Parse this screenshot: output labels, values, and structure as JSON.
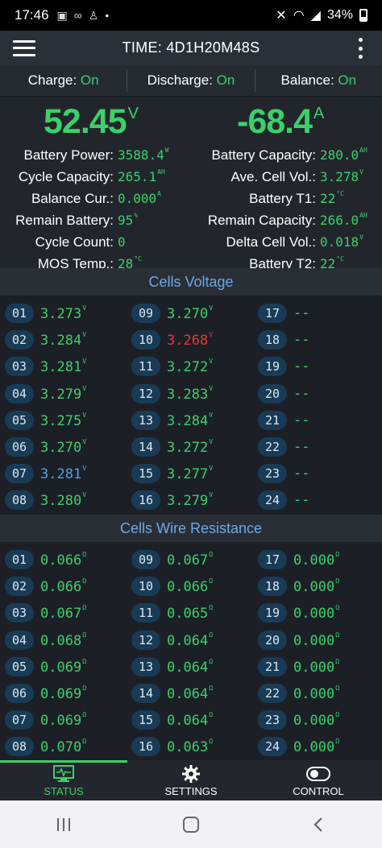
{
  "status_bar": {
    "time": "17:46",
    "icons": [
      "image-icon",
      "link-icon",
      "bluetooth-icon",
      "dot-icon"
    ],
    "battery": "34%"
  },
  "app_bar": {
    "title": "TIME: 4D1H20M48S"
  },
  "modes": [
    {
      "label": "Charge: ",
      "state": "On"
    },
    {
      "label": "Discharge: ",
      "state": "On"
    },
    {
      "label": "Balance: ",
      "state": "On"
    }
  ],
  "summary": {
    "voltage": "52.45",
    "voltage_unit": "V",
    "current": "-68.4",
    "current_unit": "A",
    "left": [
      {
        "label": "Battery Power:",
        "value": "3588.4",
        "unit": "W"
      },
      {
        "label": "Cycle Capacity:",
        "value": "265.1",
        "unit": "AH"
      },
      {
        "label": "Balance Cur.:",
        "value": "0.000",
        "unit": "A"
      },
      {
        "label": "Remain Battery:",
        "value": "95",
        "unit": "%"
      },
      {
        "label": "Cycle Count:",
        "value": "0",
        "unit": ""
      },
      {
        "label": "MOS Temp.:",
        "value": "28",
        "unit": "°C"
      }
    ],
    "right": [
      {
        "label": "Battery Capacity:",
        "value": "280.0",
        "unit": "AH"
      },
      {
        "label": "Ave. Cell Vol.:",
        "value": "3.278",
        "unit": "V"
      },
      {
        "label": "Battery T1:",
        "value": "22",
        "unit": "°C"
      },
      {
        "label": "Remain Capacity:",
        "value": "266.0",
        "unit": "AH"
      },
      {
        "label": "Delta Cell Vol.:",
        "value": "0.018",
        "unit": "V"
      },
      {
        "label": "Battery T2:",
        "value": "22",
        "unit": "°C"
      }
    ]
  },
  "cells_voltage": {
    "title": "Cells Voltage",
    "unit": "V",
    "cells": [
      {
        "id": "01",
        "value": "3.273",
        "color": "#3bd16a"
      },
      {
        "id": "02",
        "value": "3.284",
        "color": "#3bd16a"
      },
      {
        "id": "03",
        "value": "3.281",
        "color": "#3bd16a"
      },
      {
        "id": "04",
        "value": "3.279",
        "color": "#3bd16a"
      },
      {
        "id": "05",
        "value": "3.275",
        "color": "#3bd16a"
      },
      {
        "id": "06",
        "value": "3.270",
        "color": "#3bd16a"
      },
      {
        "id": "07",
        "value": "3.281",
        "color": "#4aa3e8"
      },
      {
        "id": "08",
        "value": "3.280",
        "color": "#3bd16a"
      },
      {
        "id": "09",
        "value": "3.270",
        "color": "#3bd16a"
      },
      {
        "id": "10",
        "value": "3.268",
        "color": "#e53935"
      },
      {
        "id": "11",
        "value": "3.272",
        "color": "#3bd16a"
      },
      {
        "id": "12",
        "value": "3.283",
        "color": "#3bd16a"
      },
      {
        "id": "13",
        "value": "3.284",
        "color": "#3bd16a"
      },
      {
        "id": "14",
        "value": "3.272",
        "color": "#3bd16a"
      },
      {
        "id": "15",
        "value": "3.277",
        "color": "#3bd16a"
      },
      {
        "id": "16",
        "value": "3.279",
        "color": "#3bd16a"
      },
      {
        "id": "17",
        "value": "--",
        "color": "#3bd16a"
      },
      {
        "id": "18",
        "value": "--",
        "color": "#3bd16a"
      },
      {
        "id": "19",
        "value": "--",
        "color": "#3bd16a"
      },
      {
        "id": "20",
        "value": "--",
        "color": "#3bd16a"
      },
      {
        "id": "21",
        "value": "--",
        "color": "#3bd16a"
      },
      {
        "id": "22",
        "value": "--",
        "color": "#3bd16a"
      },
      {
        "id": "23",
        "value": "--",
        "color": "#3bd16a"
      },
      {
        "id": "24",
        "value": "--",
        "color": "#3bd16a"
      }
    ]
  },
  "cells_resistance": {
    "title": "Cells Wire Resistance",
    "unit": "Ω",
    "cells": [
      {
        "id": "01",
        "value": "0.066"
      },
      {
        "id": "02",
        "value": "0.066"
      },
      {
        "id": "03",
        "value": "0.067"
      },
      {
        "id": "04",
        "value": "0.068"
      },
      {
        "id": "05",
        "value": "0.069"
      },
      {
        "id": "06",
        "value": "0.069"
      },
      {
        "id": "07",
        "value": "0.069"
      },
      {
        "id": "08",
        "value": "0.070"
      },
      {
        "id": "09",
        "value": "0.067"
      },
      {
        "id": "10",
        "value": "0.066"
      },
      {
        "id": "11",
        "value": "0.065"
      },
      {
        "id": "12",
        "value": "0.064"
      },
      {
        "id": "13",
        "value": "0.064"
      },
      {
        "id": "14",
        "value": "0.064"
      },
      {
        "id": "15",
        "value": "0.064"
      },
      {
        "id": "16",
        "value": "0.063"
      },
      {
        "id": "17",
        "value": "0.000"
      },
      {
        "id": "18",
        "value": "0.000"
      },
      {
        "id": "19",
        "value": "0.000"
      },
      {
        "id": "20",
        "value": "0.000"
      },
      {
        "id": "21",
        "value": "0.000"
      },
      {
        "id": "22",
        "value": "0.000"
      },
      {
        "id": "23",
        "value": "0.000"
      },
      {
        "id": "24",
        "value": "0.000"
      }
    ]
  },
  "bottom_nav": {
    "items": [
      {
        "label": "STATUS",
        "icon": "monitor-pulse-icon",
        "active": true
      },
      {
        "label": "SETTINGS",
        "icon": "gear-icon",
        "active": false
      },
      {
        "label": "CONTROL",
        "icon": "toggle-icon",
        "active": false
      }
    ]
  },
  "colors": {
    "accent": "#3bd16a",
    "header_text": "#6aa9e8",
    "alarm_low": "#e53935",
    "alarm_high": "#4aa3e8"
  }
}
